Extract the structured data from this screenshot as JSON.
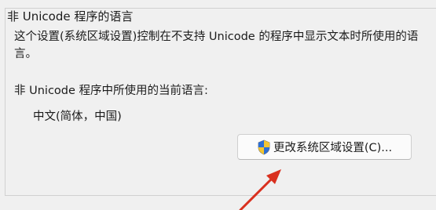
{
  "group": {
    "title": "非 Unicode 程序的语言"
  },
  "description": "这个设置(系统区域设置)控制在不支持 Unicode 的程序中显示文本时所使用的语言。",
  "current_language": {
    "label": "非 Unicode 程序中所使用的当前语言:",
    "value": "中文(简体，中国)"
  },
  "change_button": {
    "label": "更改系统区域设置(C)...",
    "icon": "uac-shield-icon"
  },
  "annotation": {
    "arrow_color": "#d9301f"
  }
}
